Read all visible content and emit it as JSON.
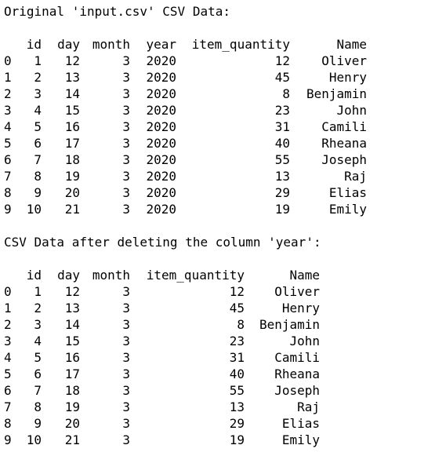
{
  "original": {
    "heading": "Original 'input.csv' CSV Data:",
    "columns": [
      "id",
      "day",
      "month",
      "year",
      "item_quantity",
      "Name"
    ],
    "rows": [
      {
        "index": "0",
        "id": "1",
        "day": "12",
        "month": "3",
        "year": "2020",
        "item_quantity": "12",
        "name": "Oliver"
      },
      {
        "index": "1",
        "id": "2",
        "day": "13",
        "month": "3",
        "year": "2020",
        "item_quantity": "45",
        "name": "Henry"
      },
      {
        "index": "2",
        "id": "3",
        "day": "14",
        "month": "3",
        "year": "2020",
        "item_quantity": "8",
        "name": "Benjamin"
      },
      {
        "index": "3",
        "id": "4",
        "day": "15",
        "month": "3",
        "year": "2020",
        "item_quantity": "23",
        "name": "John"
      },
      {
        "index": "4",
        "id": "5",
        "day": "16",
        "month": "3",
        "year": "2020",
        "item_quantity": "31",
        "name": "Camili"
      },
      {
        "index": "5",
        "id": "6",
        "day": "17",
        "month": "3",
        "year": "2020",
        "item_quantity": "40",
        "name": "Rheana"
      },
      {
        "index": "6",
        "id": "7",
        "day": "18",
        "month": "3",
        "year": "2020",
        "item_quantity": "55",
        "name": "Joseph"
      },
      {
        "index": "7",
        "id": "8",
        "day": "19",
        "month": "3",
        "year": "2020",
        "item_quantity": "13",
        "name": "Raj"
      },
      {
        "index": "8",
        "id": "9",
        "day": "20",
        "month": "3",
        "year": "2020",
        "item_quantity": "29",
        "name": "Elias"
      },
      {
        "index": "9",
        "id": "10",
        "day": "21",
        "month": "3",
        "year": "2020",
        "item_quantity": "19",
        "name": "Emily"
      }
    ]
  },
  "after_delete": {
    "heading": "CSV Data after deleting the column 'year':",
    "columns": [
      "id",
      "day",
      "month",
      "item_quantity",
      "Name"
    ],
    "rows": [
      {
        "index": "0",
        "id": "1",
        "day": "12",
        "month": "3",
        "item_quantity": "12",
        "name": "Oliver"
      },
      {
        "index": "1",
        "id": "2",
        "day": "13",
        "month": "3",
        "item_quantity": "45",
        "name": "Henry"
      },
      {
        "index": "2",
        "id": "3",
        "day": "14",
        "month": "3",
        "item_quantity": "8",
        "name": "Benjamin"
      },
      {
        "index": "3",
        "id": "4",
        "day": "15",
        "month": "3",
        "item_quantity": "23",
        "name": "John"
      },
      {
        "index": "4",
        "id": "5",
        "day": "16",
        "month": "3",
        "item_quantity": "31",
        "name": "Camili"
      },
      {
        "index": "5",
        "id": "6",
        "day": "17",
        "month": "3",
        "item_quantity": "40",
        "name": "Rheana"
      },
      {
        "index": "6",
        "id": "7",
        "day": "18",
        "month": "3",
        "item_quantity": "55",
        "name": "Joseph"
      },
      {
        "index": "7",
        "id": "8",
        "day": "19",
        "month": "3",
        "item_quantity": "13",
        "name": "Raj"
      },
      {
        "index": "8",
        "id": "9",
        "day": "20",
        "month": "3",
        "item_quantity": "29",
        "name": "Elias"
      },
      {
        "index": "9",
        "id": "10",
        "day": "21",
        "month": "3",
        "item_quantity": "19",
        "name": "Emily"
      }
    ]
  }
}
